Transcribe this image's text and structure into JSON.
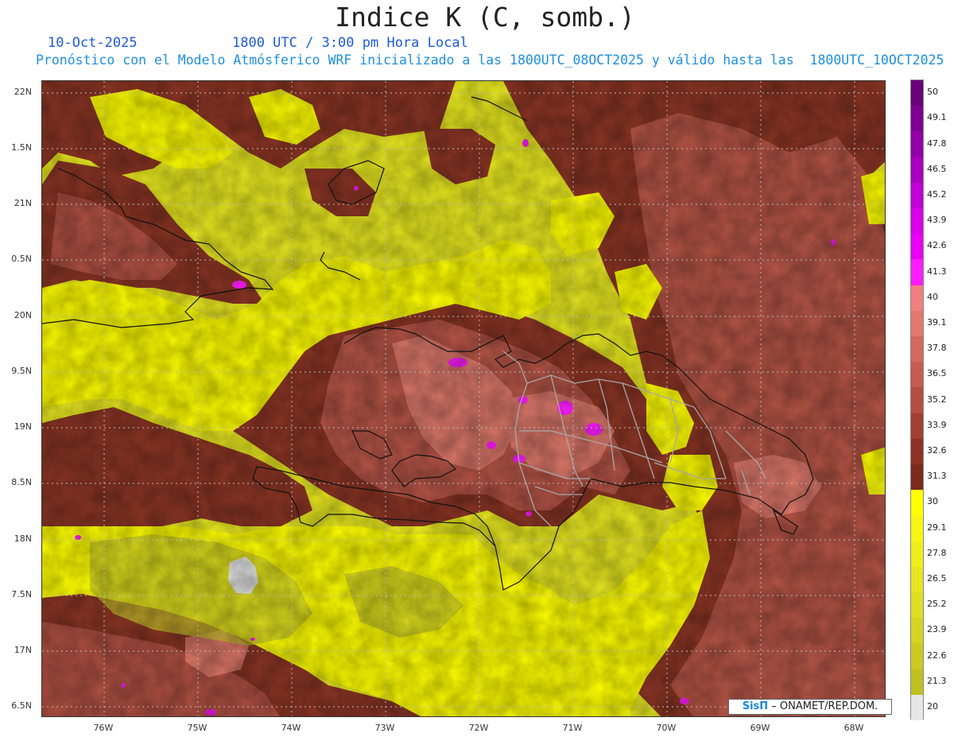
{
  "title": "Indice K (C, somb.)",
  "date": "10-Oct-2025",
  "time": "1800 UTC / 3:00 pm Hora Local",
  "info": "Pronóstico con el Modelo Atmósferico WRF inicializado a las 1800UTC_08OCT2025 y válido hasta las  1800UTC_10OCT2025",
  "credit": {
    "brand": "SisΠ",
    "text": " – ONAMET/REP.DOM."
  },
  "map_data": {
    "type": "heatmap",
    "lat_range": [
      16.5,
      22
    ],
    "lon_range": [
      -76.6,
      -67.6
    ],
    "lat_ticks": [
      "22N",
      "1.5N",
      "21N",
      "0.5N",
      "20N",
      "9.5N",
      "19N",
      "8.5N",
      "18N",
      "7.5N",
      "17N",
      "6.5N"
    ],
    "lon_ticks": [
      "76W",
      "75W",
      "74W",
      "73W",
      "72W",
      "71W",
      "70W",
      "69W",
      "68W"
    ]
  },
  "legend": {
    "labels": [
      "50",
      "49.1",
      "47.8",
      "46.5",
      "45.2",
      "43.9",
      "42.6",
      "41.3",
      "40",
      "39.1",
      "37.8",
      "36.5",
      "35.2",
      "33.9",
      "32.6",
      "31.3",
      "30",
      "29.1",
      "27.8",
      "26.5",
      "25.2",
      "23.9",
      "22.6",
      "21.3",
      "20"
    ],
    "colors": [
      "#6a007a",
      "#7e0090",
      "#9400a8",
      "#ab00c0",
      "#c200d6",
      "#d800e8",
      "#ea00f4",
      "#ff1cff",
      "#f08080",
      "#e27870",
      "#d26a5e",
      "#c45c50",
      "#b44e40",
      "#a24032",
      "#8e3226",
      "#7c2a1c",
      "#ffff00",
      "#f6f612",
      "#eeee1c",
      "#e6e620",
      "#dede22",
      "#d4d424",
      "#caca22",
      "#c0c020",
      "#e6e6e6"
    ]
  }
}
